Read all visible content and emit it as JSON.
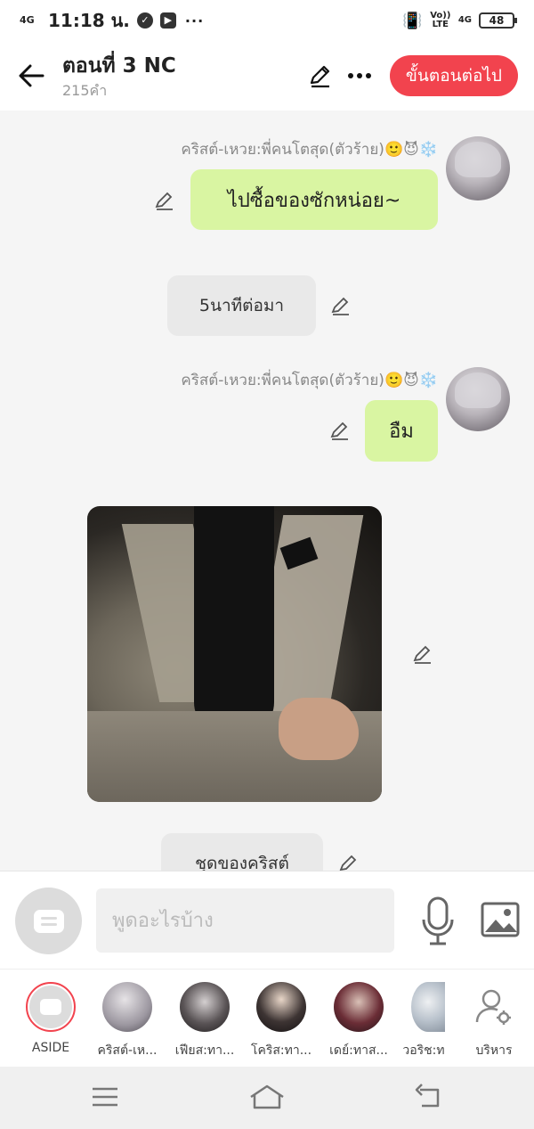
{
  "status_bar": {
    "network": "4G",
    "time": "11:18 น.",
    "more": "···",
    "volte": "Vo)) LTE",
    "net_right": "4G",
    "battery": "48"
  },
  "header": {
    "title": "ตอนที่ 3 NC",
    "word_count": "215คำ",
    "next_button": "ขั้นตอนต่อไป"
  },
  "messages": [
    {
      "type": "speech",
      "sender": "คริสต์-เหวย:พี่คนโตสุด(ตัวร้าย)🙂😈❄️",
      "text": "ไปซื้อของซักหน่อย~"
    },
    {
      "type": "narration",
      "text": "5นาทีต่อมา"
    },
    {
      "type": "speech",
      "sender": "คริสต์-เหวย:พี่คนโตสุด(ตัวร้าย)🙂😈❄️",
      "text": "อืม"
    },
    {
      "type": "image"
    },
    {
      "type": "narration",
      "text": "ชุดของคริสต์"
    }
  ],
  "composer": {
    "placeholder": "พูดอะไรบ้าง"
  },
  "characters": [
    {
      "name": "ASIDE",
      "selected": true
    },
    {
      "name": "คริสต์-เห..."
    },
    {
      "name": "เฟียส:ทา..."
    },
    {
      "name": "โคริส:ทา..."
    },
    {
      "name": "เดย์:ทาส..."
    },
    {
      "name": "วอริช:ท"
    },
    {
      "name": "บริหาร"
    }
  ],
  "colors": {
    "accent": "#f2434e",
    "bubble_green": "#d9f5a2",
    "narration_gray": "#e9e9e9"
  }
}
